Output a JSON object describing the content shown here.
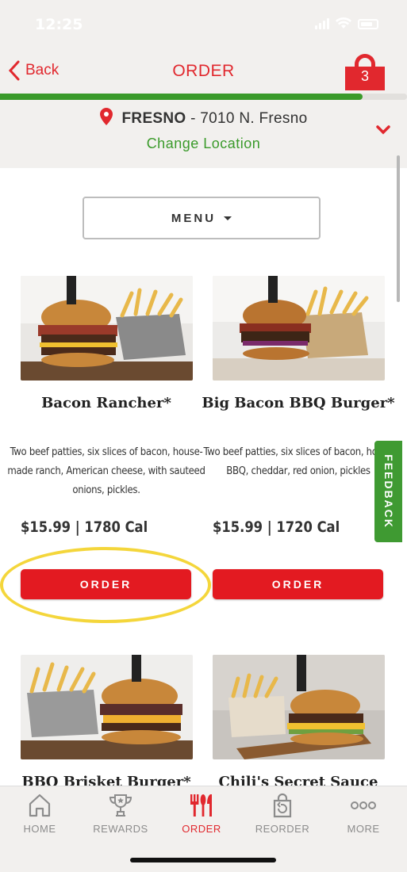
{
  "status_bar": {
    "time": "12:25"
  },
  "header": {
    "back_label": "Back",
    "title": "ORDER",
    "cart_count": "3",
    "progress": 0.89
  },
  "location": {
    "city": "FRESNO",
    "address": " - 7010 N. Fresno",
    "change_label": "Change Location"
  },
  "menu": {
    "label": "MENU"
  },
  "products": [
    {
      "name": "Bacon Rancher*",
      "description": "Two beef patties, six slices of bacon, house-made ranch, American cheese, with sauteed onions, pickles.",
      "price": "$15.99 | 1780 Cal",
      "order_label": "ORDER"
    },
    {
      "name": "Big Bacon BBQ Burger*",
      "description": "Two beef patties, six slices of bacon, house BBQ, cheddar, red onion, pickles",
      "price": "$15.99 | 1720 Cal",
      "order_label": "ORDER"
    },
    {
      "name": "BBQ Brisket Burger*"
    },
    {
      "name": "Chili's Secret Sauce"
    }
  ],
  "feedback": {
    "label": "FEEDBACK"
  },
  "tabs": [
    {
      "label": "HOME",
      "icon": "home-icon"
    },
    {
      "label": "REWARDS",
      "icon": "trophy-icon"
    },
    {
      "label": "ORDER",
      "icon": "utensils-icon"
    },
    {
      "label": "REORDER",
      "icon": "reorder-bag-icon"
    },
    {
      "label": "MORE",
      "icon": "more-dots-icon"
    }
  ],
  "colors": {
    "brand_red": "#e1282e",
    "green": "#3a9a2a",
    "highlight": "#f4d63b"
  }
}
